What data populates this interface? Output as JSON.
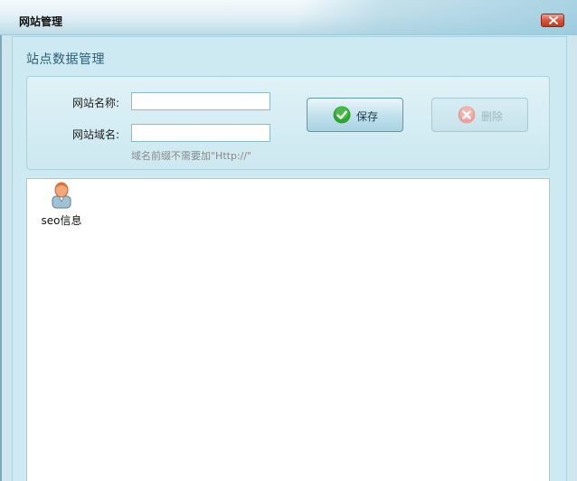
{
  "window": {
    "title": "网站管理"
  },
  "section": {
    "heading": "站点数据管理"
  },
  "form": {
    "name_label": "网站名称:",
    "name_value": "",
    "domain_label": "网站域名:",
    "domain_value": "",
    "hint": "域名前缀不需要加\"Http://\""
  },
  "buttons": {
    "save_label": "保存",
    "delete_label": "删除"
  },
  "items": [
    {
      "label": "seo信息",
      "icon": "person-icon"
    }
  ],
  "colors": {
    "window_bg": "#cde9f1",
    "save_check": "#2fa52f",
    "delete_x": "#e9a29a",
    "close_btn": "#d9553b"
  }
}
